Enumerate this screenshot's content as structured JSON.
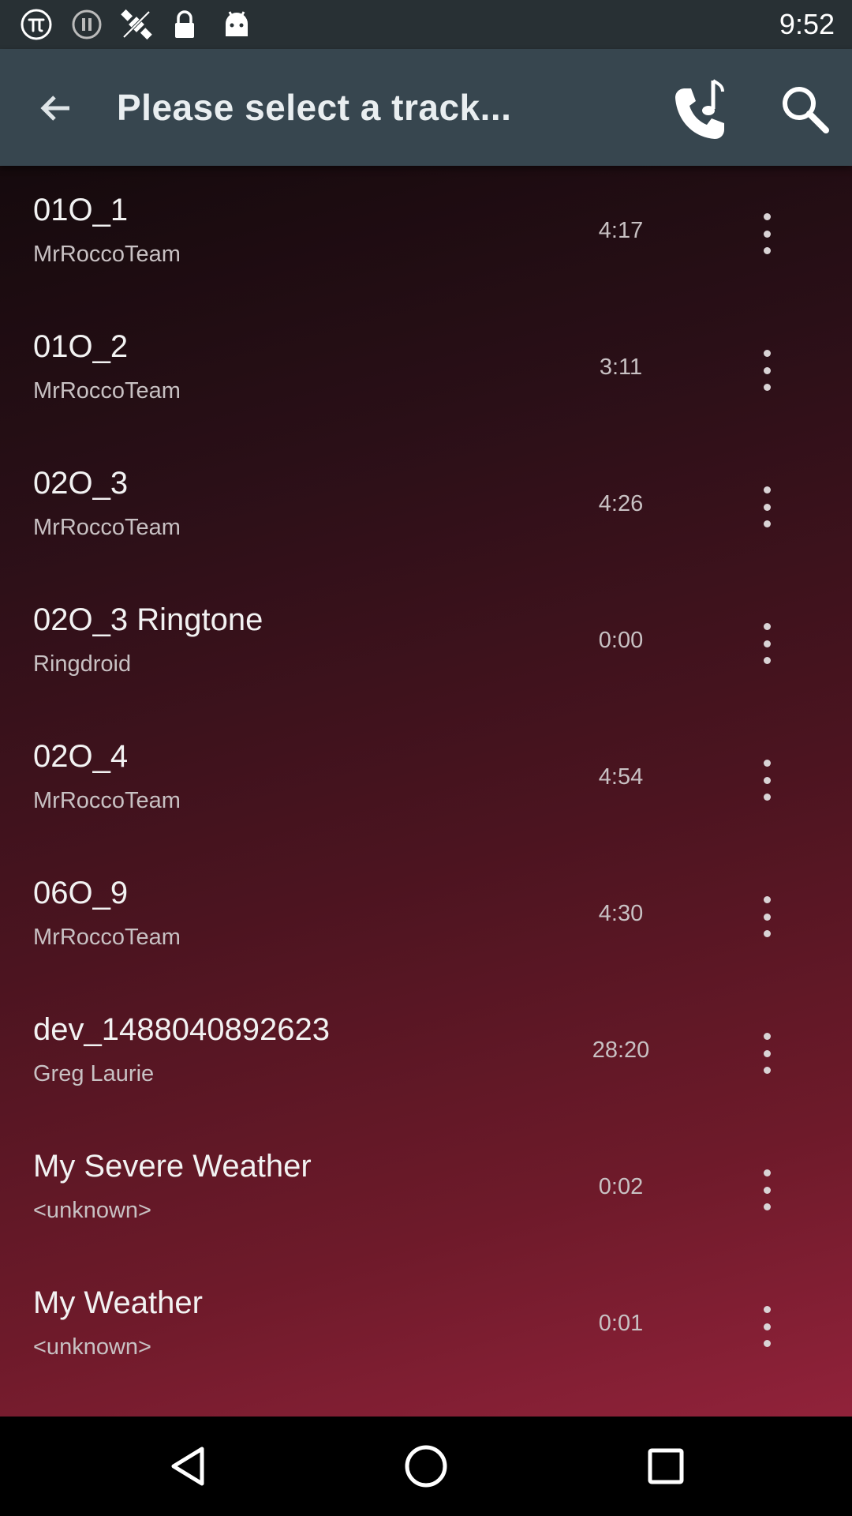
{
  "status_bar": {
    "time": "9:52",
    "icons": [
      "pi-icon",
      "skip-icon",
      "no-satellite-icon",
      "lock-icon",
      "android-icon"
    ]
  },
  "toolbar": {
    "title": "Please select a track...",
    "back_icon": "arrow-back-icon",
    "ringtone_icon": "phone-ringtone-icon",
    "search_icon": "search-icon"
  },
  "tracks": [
    {
      "title": "01O_1",
      "artist": "MrRoccoTeam",
      "duration": "4:17"
    },
    {
      "title": "01O_2",
      "artist": "MrRoccoTeam",
      "duration": "3:11"
    },
    {
      "title": "02O_3",
      "artist": "MrRoccoTeam",
      "duration": "4:26"
    },
    {
      "title": "02O_3 Ringtone",
      "artist": "Ringdroid",
      "duration": "0:00"
    },
    {
      "title": "02O_4",
      "artist": "MrRoccoTeam",
      "duration": "4:54"
    },
    {
      "title": "06O_9",
      "artist": "MrRoccoTeam",
      "duration": "4:30"
    },
    {
      "title": "dev_1488040892623",
      "artist": "Greg Laurie",
      "duration": "28:20"
    },
    {
      "title": "My Severe Weather",
      "artist": "<unknown>",
      "duration": "0:02"
    },
    {
      "title": "My Weather",
      "artist": "<unknown>",
      "duration": "0:01"
    }
  ],
  "colors": {
    "toolbar": "#37464f",
    "status_bar": "#283034",
    "list_gradient_start": "#150a0d",
    "list_gradient_end": "#91223a"
  }
}
